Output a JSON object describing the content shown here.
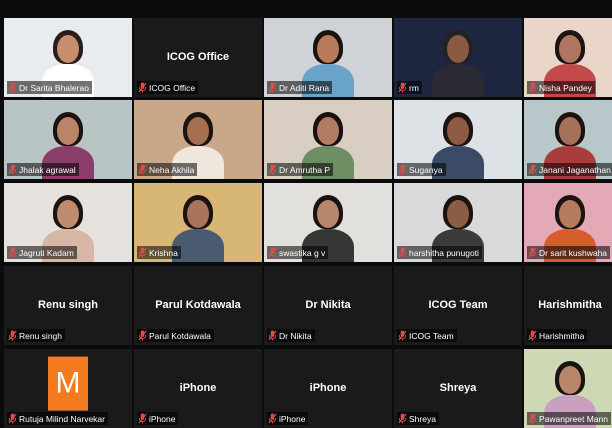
{
  "tiles": [
    {
      "name": "Dr Sarita Bhalerao",
      "center": "",
      "video": true,
      "bg": "#e8ecef",
      "skin": "#c68e6e",
      "shirt": "#ffffff",
      "hair": "#2a1d17",
      "active": true
    },
    {
      "name": "ICOG Office",
      "center": "ICOG Office",
      "video": false
    },
    {
      "name": "Dr Aditi Rana",
      "center": "",
      "video": true,
      "bg": "#cfd3d8",
      "skin": "#b77a5b",
      "shirt": "#6aa3c8",
      "hair": "#1a120e"
    },
    {
      "name": "rm",
      "center": "",
      "video": true,
      "bg": "#1d2540",
      "skin": "#8a5a44",
      "shirt": "#2a2a33",
      "hair": "#222222"
    },
    {
      "name": "Nisha Pandey",
      "center": "",
      "video": true,
      "bg": "#e9d6c9",
      "skin": "#b07560",
      "shirt": "#c24a4a",
      "hair": "#1c1410"
    },
    {
      "name": "Jhalak agrawal",
      "center": "",
      "video": true,
      "bg": "#b9c4c4",
      "skin": "#b98467",
      "shirt": "#8b3e6b",
      "hair": "#1a1310"
    },
    {
      "name": "Neha Akhila",
      "center": "",
      "video": true,
      "bg": "#c9a88a",
      "skin": "#a56f50",
      "shirt": "#efe6dd",
      "hair": "#1a1310"
    },
    {
      "name": "Dr Amrutha P",
      "center": "",
      "video": true,
      "bg": "#d8cfc2",
      "skin": "#b07b5e",
      "shirt": "#6d8d63",
      "hair": "#161010"
    },
    {
      "name": "Suganya",
      "center": "",
      "video": true,
      "bg": "#dde2e6",
      "skin": "#8c5a45",
      "shirt": "#3b4a66",
      "hair": "#1a1310"
    },
    {
      "name": "Janani Jaganathan",
      "center": "",
      "video": true,
      "bg": "#b8c7c9",
      "skin": "#a57158",
      "shirt": "#a93c3c",
      "hair": "#1a1310"
    },
    {
      "name": "Jagruti Kadam",
      "center": "",
      "video": true,
      "bg": "#e5e1dc",
      "skin": "#c08a6d",
      "shirt": "#d7b7a6",
      "hair": "#1a1310"
    },
    {
      "name": "Krishna",
      "center": "",
      "video": true,
      "bg": "#d8b676",
      "skin": "#a8745a",
      "shirt": "#4a5a70",
      "hair": "#1a1310"
    },
    {
      "name": "swastika g v",
      "center": "",
      "video": true,
      "bg": "#e2e0dd",
      "skin": "#b8866a",
      "shirt": "#363636",
      "hair": "#1a1310"
    },
    {
      "name": "harshitha punugoti",
      "center": "",
      "video": true,
      "bg": "#d9d9d9",
      "skin": "#8b5c46",
      "shirt": "#3b3b3b",
      "hair": "#1a1310"
    },
    {
      "name": "Dr sarit kushwaha",
      "center": "",
      "video": true,
      "bg": "#e3a9b7",
      "skin": "#b57b5f",
      "shirt": "#d65c2e",
      "hair": "#1a1310"
    },
    {
      "name": "Renu singh",
      "center": "Renu singh",
      "video": false
    },
    {
      "name": "Parul Kotdawala",
      "center": "Parul Kotdawala",
      "video": false
    },
    {
      "name": "Dr Nikita",
      "center": "Dr Nikita",
      "video": false
    },
    {
      "name": "ICOG Team",
      "center": "ICOG Team",
      "video": false
    },
    {
      "name": "Harishmitha",
      "center": "Harishmitha",
      "video": false
    },
    {
      "name": "Rutuja Milind Narvekar",
      "center": "",
      "video": false,
      "avatar": "M"
    },
    {
      "name": "iPhone",
      "center": "iPhone",
      "video": false
    },
    {
      "name": "iPhone",
      "center": "iPhone",
      "video": false
    },
    {
      "name": "Shreya",
      "center": "Shreya",
      "video": false
    },
    {
      "name": "Pawanpreet Mann",
      "center": "",
      "video": true,
      "bg": "#cfd8b5",
      "skin": "#b8866a",
      "shirt": "#c9a0c0",
      "hair": "#1a1310"
    }
  ],
  "icons": {
    "muted": "mic-muted-icon"
  },
  "colors": {
    "active_border": "#d6e63a",
    "muted_red": "#e8484a",
    "tile_bg": "#1a1a1a",
    "avatar_bg": "#f47a20"
  }
}
